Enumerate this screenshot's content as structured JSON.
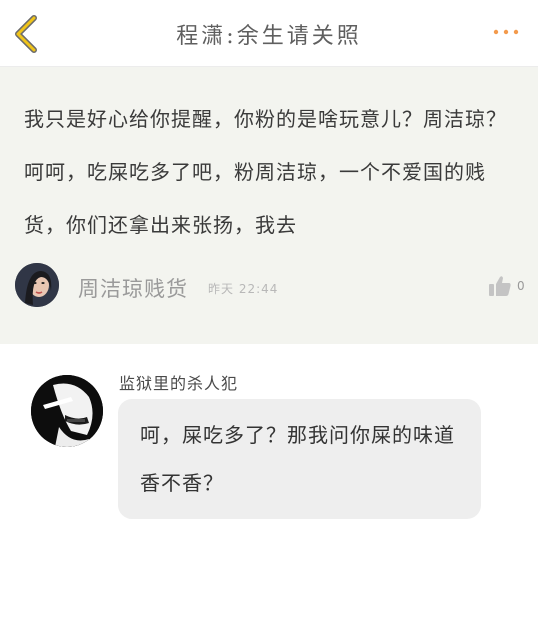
{
  "header": {
    "title": "程潇:余生请关照",
    "back_icon": "chevron-left-icon",
    "more_icon": "more-dots-icon",
    "accent_color": "#f0c419",
    "more_color": "#f39a4c"
  },
  "comment": {
    "text": "我只是好心给你提醒，你粉的是啥玩意儿？周洁琼？呵呵，吃屎吃多了吧，粉周洁琼，一个不爱国的贱货，你们还拿出来张扬，我去",
    "author": "周洁琼贱货",
    "time": "昨天 22:44",
    "like_icon": "thumbs-up-icon",
    "likes": "0",
    "avatar": "user-avatar"
  },
  "reply": {
    "author": "监狱里的杀人犯",
    "text": "呵，屎吃多了？那我问你屎的味道香不香？",
    "avatar": "reply-user-avatar"
  }
}
